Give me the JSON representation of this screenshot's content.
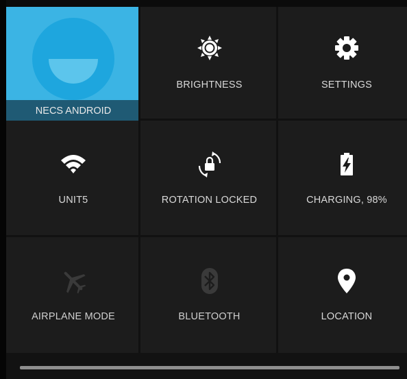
{
  "quick_settings": {
    "user": {
      "label": "NECS ANDROID",
      "color": "#3bb4e4"
    },
    "brightness": {
      "label": "BRIGHTNESS",
      "icon": "brightness-icon"
    },
    "settings": {
      "label": "SETTINGS",
      "icon": "gear-icon"
    },
    "wifi": {
      "label": "UNIT5",
      "icon": "wifi-icon"
    },
    "rotation": {
      "label": "ROTATION LOCKED",
      "icon": "rotation-lock-icon"
    },
    "battery": {
      "label": "CHARGING, 98%",
      "icon": "battery-charging-icon"
    },
    "airplane": {
      "label": "AIRPLANE MODE",
      "icon": "airplane-icon"
    },
    "bluetooth": {
      "label": "BLUETOOTH",
      "icon": "bluetooth-icon"
    },
    "location": {
      "label": "LOCATION",
      "icon": "location-pin-icon"
    }
  }
}
